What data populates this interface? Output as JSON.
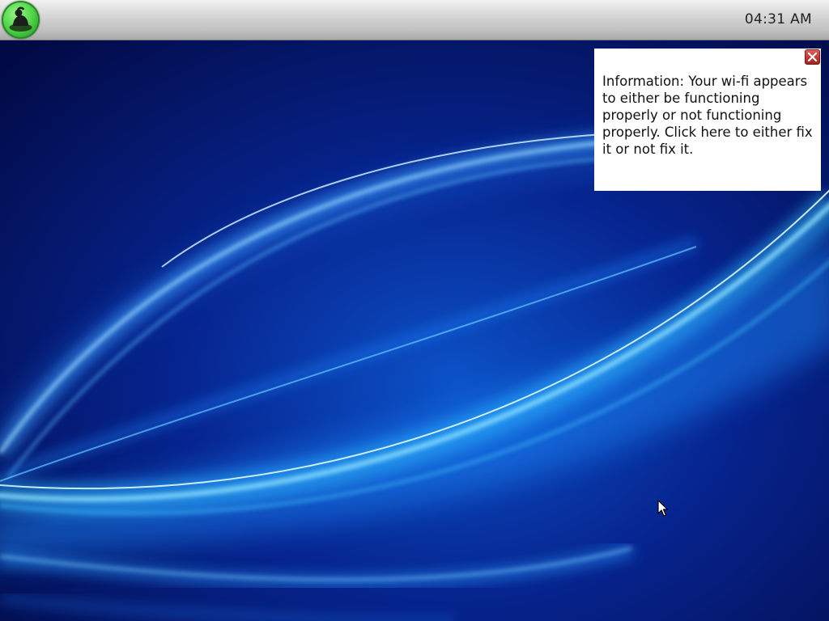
{
  "panel": {
    "clock": "04:31 AM",
    "start_button_icon": "app-menu-icon",
    "start_button_color": "#3cbf35"
  },
  "desktop": {
    "wallpaper_base_color": "#04125e",
    "wallpaper_accent_color": "#2aa8ff"
  },
  "notification": {
    "message": "Information: Your wi-fi appears to either be functioning properly or not functioning properly. Click here to either fix it or not fix it.",
    "close_icon": "close-icon",
    "close_color": "#c0352f"
  },
  "cursor": {
    "icon": "arrow-cursor-icon"
  }
}
